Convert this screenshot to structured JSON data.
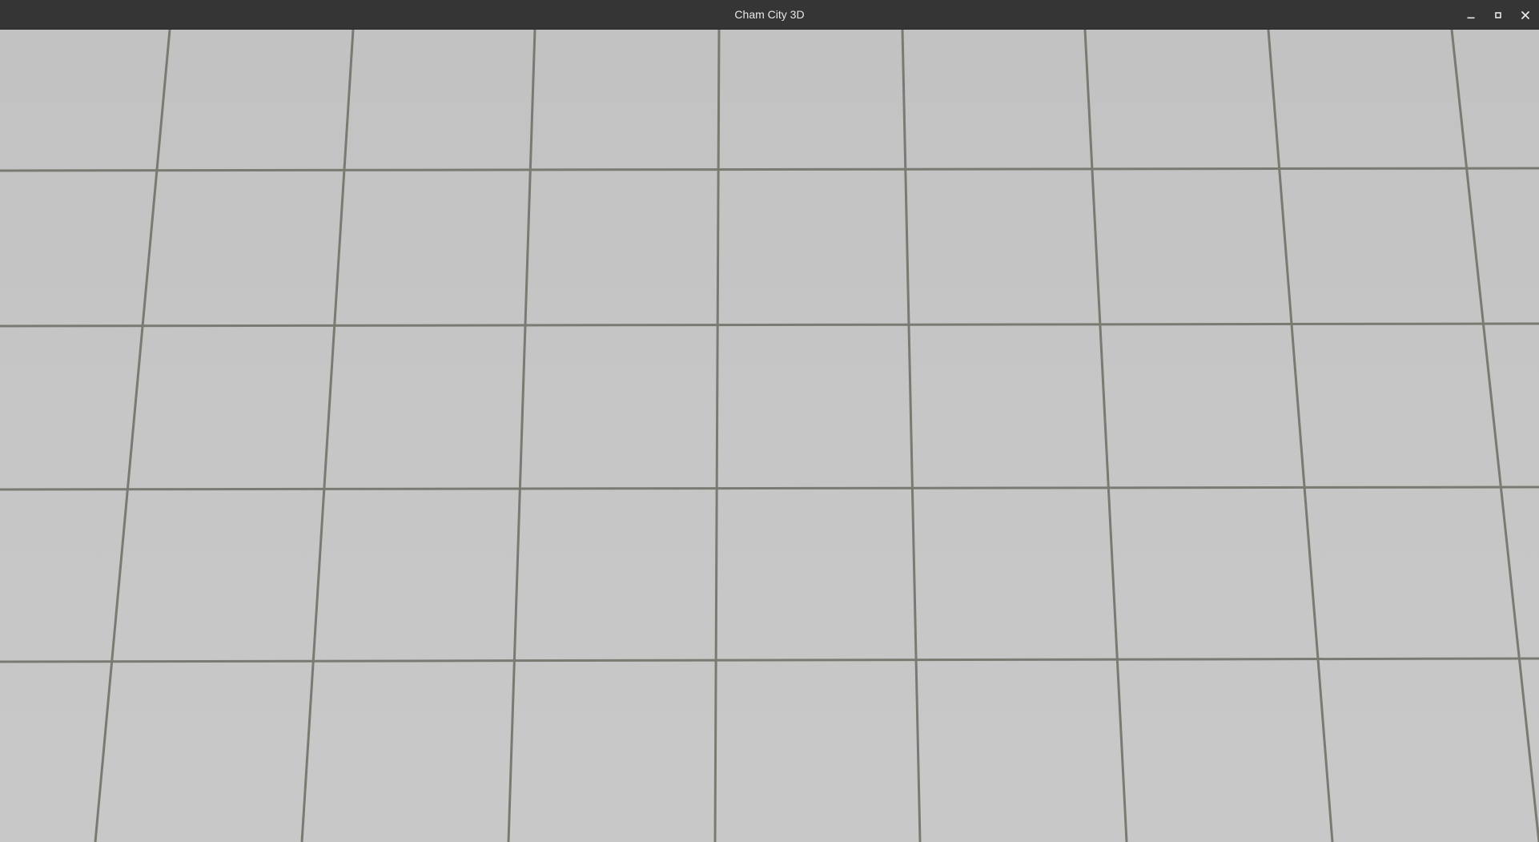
{
  "window": {
    "title": "Cham City 3D",
    "controls": {
      "minimize_icon": "minimize-icon",
      "maximize_icon": "maximize-icon",
      "close_icon": "close-icon"
    }
  },
  "scene": {
    "description_type": "3d-viewport",
    "floor_color": "#c6c6c6",
    "grout_color": "#7a7a72",
    "titlebar_color": "#353535"
  }
}
